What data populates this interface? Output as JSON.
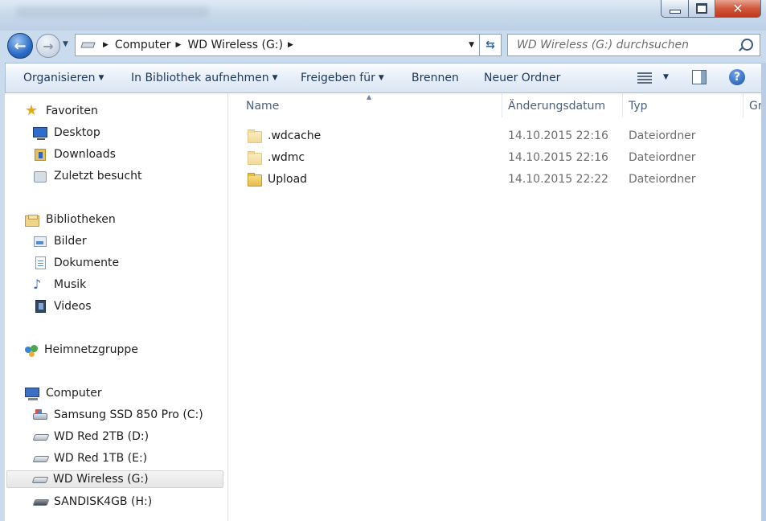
{
  "address": {
    "crumbs": [
      "Computer",
      "WD Wireless (G:)"
    ]
  },
  "search": {
    "placeholder": "WD Wireless (G:) durchsuchen"
  },
  "toolbar": {
    "organize": "Organisieren",
    "include_library": "In Bibliothek aufnehmen",
    "share": "Freigeben für",
    "burn": "Brennen",
    "new_folder": "Neuer Ordner"
  },
  "sidebar": {
    "favorites": {
      "label": "Favoriten",
      "items": [
        {
          "label": "Desktop",
          "icon": "desktop-icon"
        },
        {
          "label": "Downloads",
          "icon": "downloads-icon"
        },
        {
          "label": "Zuletzt besucht",
          "icon": "recent-places-icon"
        }
      ]
    },
    "libraries": {
      "label": "Bibliotheken",
      "items": [
        {
          "label": "Bilder",
          "icon": "pictures-icon"
        },
        {
          "label": "Dokumente",
          "icon": "documents-icon"
        },
        {
          "label": "Musik",
          "icon": "music-icon"
        },
        {
          "label": "Videos",
          "icon": "videos-icon"
        }
      ]
    },
    "homegroup": {
      "label": "Heimnetzgruppe"
    },
    "computer": {
      "label": "Computer",
      "items": [
        {
          "label": "Samsung SSD 850 Pro (C:)",
          "icon": "system-drive-icon"
        },
        {
          "label": "WD Red 2TB (D:)",
          "icon": "drive-icon"
        },
        {
          "label": "WD Red 1TB (E:)",
          "icon": "drive-icon"
        },
        {
          "label": "WD Wireless (G:)",
          "icon": "drive-icon",
          "selected": true
        },
        {
          "label": "SANDISK4GB (H:)",
          "icon": "usb-drive-icon"
        }
      ]
    }
  },
  "columns": {
    "name": "Name",
    "date": "Änderungsdatum",
    "type": "Typ",
    "size": "Gr"
  },
  "files": [
    {
      "name": ".wdcache",
      "date": "14.10.2015 22:16",
      "type": "Dateiordner",
      "hidden": true
    },
    {
      "name": ".wdmc",
      "date": "14.10.2015 22:16",
      "type": "Dateiordner",
      "hidden": true
    },
    {
      "name": "Upload",
      "date": "14.10.2015 22:22",
      "type": "Dateiordner",
      "hidden": false
    }
  ],
  "colors": {
    "toolbar_text": "#1e395b",
    "header_text": "#4c607a",
    "secondary_text": "#6d6d6d",
    "folder": "#e7bb48"
  }
}
